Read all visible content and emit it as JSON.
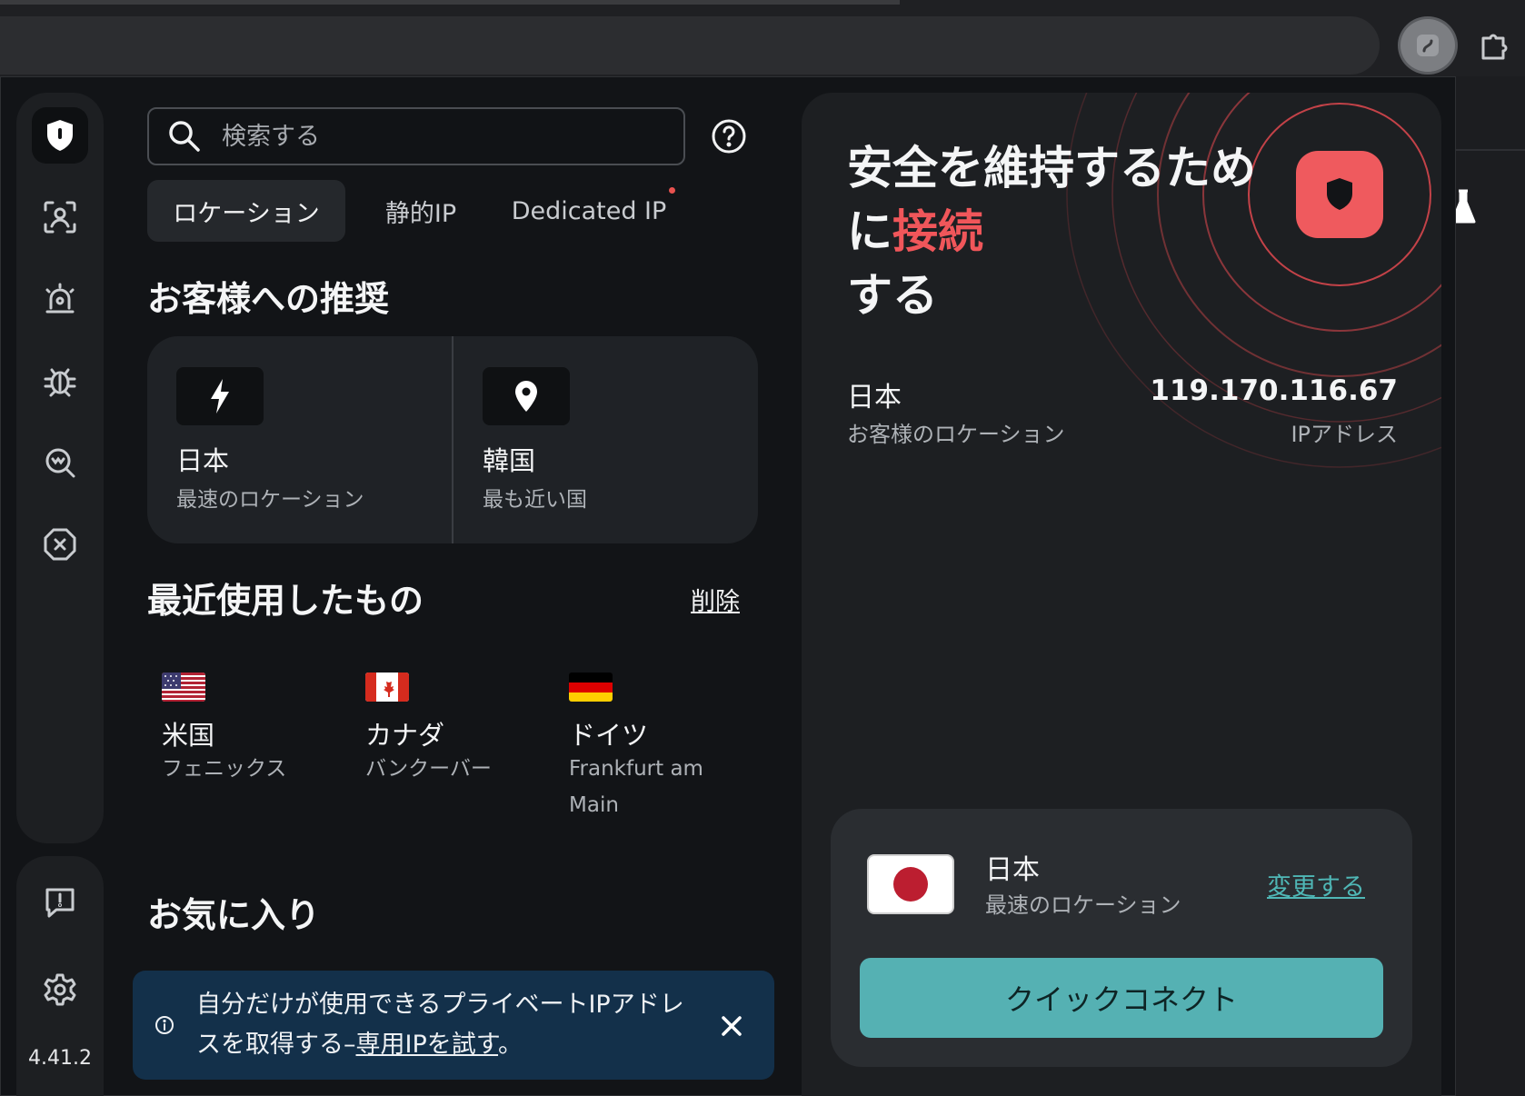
{
  "search": {
    "placeholder": "検索する"
  },
  "tabs": [
    {
      "label": "ロケーション",
      "active": true
    },
    {
      "label": "静的IP"
    },
    {
      "label": "Dedicated IP",
      "has_dot": true
    }
  ],
  "recommendations": {
    "title": "お客様への推奨",
    "items": [
      {
        "icon": "lightning-icon",
        "name": "日本",
        "sub": "最速のロケーション"
      },
      {
        "icon": "location-pin-icon",
        "name": "韓国",
        "sub": "最も近い国"
      }
    ]
  },
  "recent": {
    "title": "最近使用したもの",
    "clear_label": "削除",
    "items": [
      {
        "flag": "us-flag-icon",
        "country": "米国",
        "city": "フェニックス"
      },
      {
        "flag": "ca-flag-icon",
        "country": "カナダ",
        "city": "バンクーバー"
      },
      {
        "flag": "de-flag-icon",
        "country": "ドイツ",
        "city": "Frankfurt am Main"
      }
    ]
  },
  "favorites": {
    "title": "お気に入り"
  },
  "banner": {
    "text": "自分だけが使用できるプライベートIPアドレスを取得する–",
    "link": "専用IPを試す",
    "suffix": "。"
  },
  "sidebar": {
    "icons": [
      "vpn-shield-icon",
      "face-scan-icon",
      "alert-icon",
      "bug-icon",
      "search-scan-icon",
      "block-icon"
    ],
    "bottom_icons": [
      "feedback-icon",
      "settings-gear-icon"
    ],
    "version": "4.41.2"
  },
  "status": {
    "title_line1": "安全を維持するため",
    "title_line2a": "に",
    "title_line2b": "接続",
    "title_line3": "する",
    "location_value": "日本",
    "location_label": "お客様のロケーション",
    "ip_value": "119.170.116.67",
    "ip_label": "IPアドレス"
  },
  "quick": {
    "flag": "jp-flag-icon",
    "country": "日本",
    "sub": "最速のロケーション",
    "change_label": "変更する",
    "button_label": "クイックコネクト"
  },
  "colors": {
    "accent_red": "#ef5a5e",
    "accent_teal": "#55b1b3",
    "background": "#121417",
    "panel": "#1d1f22",
    "banner": "#13304a"
  }
}
